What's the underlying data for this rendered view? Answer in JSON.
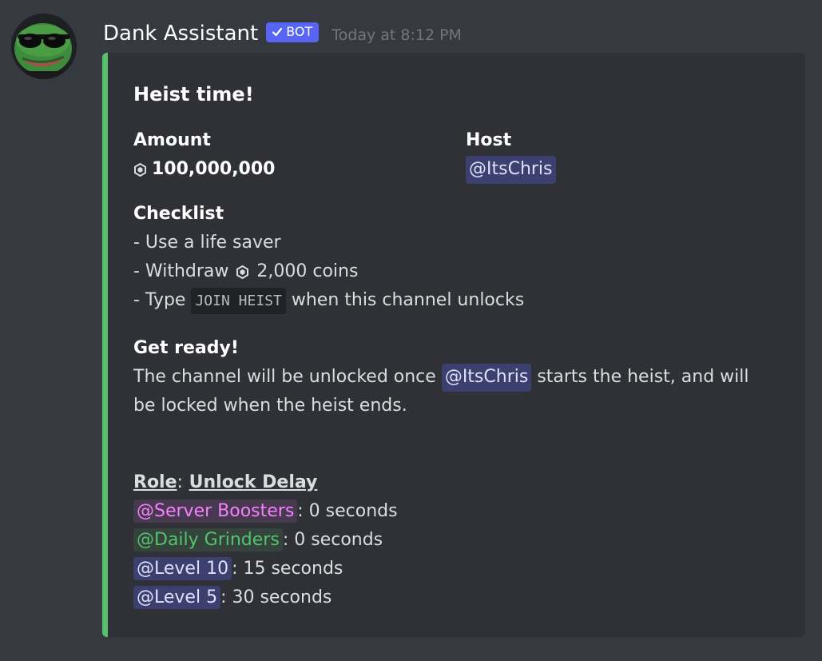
{
  "message": {
    "username": "Dank Assistant",
    "bot_tag": "BOT",
    "timestamp": "Today at 8:12 PM"
  },
  "embed": {
    "accent_color": "#57c26e",
    "title": "Heist time!",
    "amount": {
      "name": "Amount",
      "value": "100,000,000"
    },
    "host": {
      "name": "Host",
      "value": "@ItsChris"
    },
    "checklist": {
      "name": "Checklist",
      "line1": "- Use a life saver",
      "line2_prefix": "- Withdraw",
      "line2_suffix": "2,000 coins",
      "line3_prefix": "- Type",
      "line3_code": "JOIN HEIST",
      "line3_suffix": "when this channel unlocks"
    },
    "get_ready": {
      "name": "Get ready!",
      "text1": "The channel will be unlocked once",
      "mention": "@ItsChris",
      "text2": "starts the heist, and will",
      "text3": "be locked when the heist ends."
    },
    "roles": {
      "header_role": "Role",
      "header_sep": ":",
      "header_delay": "Unlock Delay",
      "items": [
        {
          "role": "@Server Boosters",
          "delay": ": 0 seconds"
        },
        {
          "role": "@Daily Grinders",
          "delay": ": 0 seconds"
        },
        {
          "role": "@Level 10",
          "delay": ": 15 seconds"
        },
        {
          "role": "@Level 5",
          "delay": ": 30 seconds"
        }
      ]
    }
  },
  "icons": {
    "avatar": "pepe-sunglasses-avatar",
    "bot_check": "checkmark-icon",
    "coin": "coin-icon"
  }
}
